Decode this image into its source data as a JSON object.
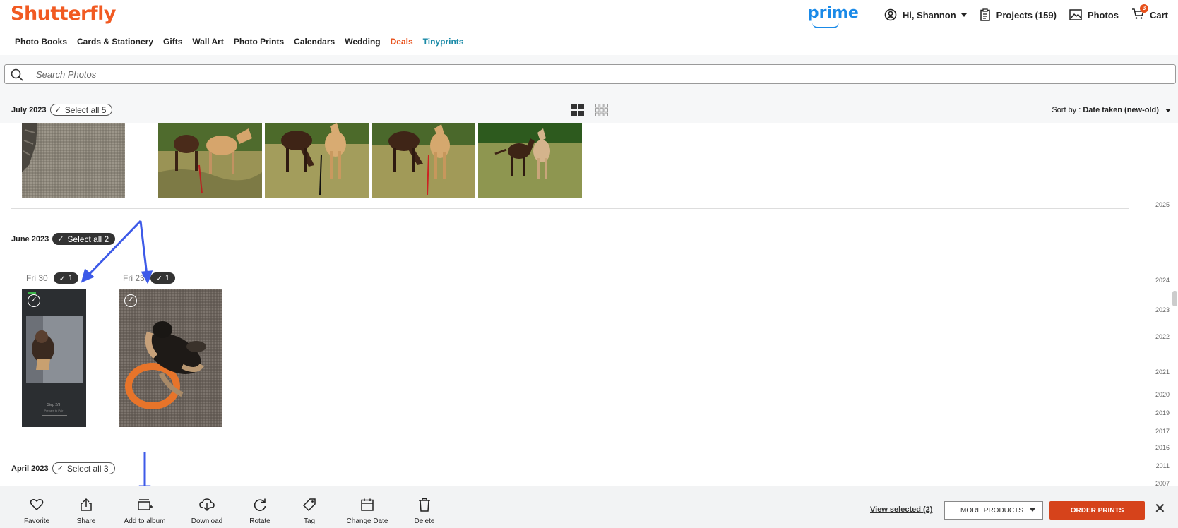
{
  "header": {
    "logo": "Shutterfly",
    "prime": "prime",
    "greeting": "Hi, Shannon",
    "projects": "Projects (159)",
    "photos": "Photos",
    "cart": "Cart",
    "cart_count": "3",
    "brand_color": "#f15a22"
  },
  "nav": [
    "Photo Books",
    "Cards & Stationery",
    "Gifts",
    "Wall Art",
    "Photo Prints",
    "Calendars",
    "Wedding",
    "Deals",
    "Tinyprints"
  ],
  "search": {
    "placeholder": "Search Photos"
  },
  "sort": {
    "prefix": "Sort by : ",
    "value": "Date taken (new-old)"
  },
  "groups": {
    "july": {
      "label": "July 2023",
      "select": "Select all 5"
    },
    "june": {
      "label": "June 2023",
      "select": "Select all 2"
    },
    "april": {
      "label": "April 2023",
      "select": "Select all 3"
    }
  },
  "days": [
    {
      "label": "Fri 30",
      "count": "1"
    },
    {
      "label": "Fri 23",
      "count": "1"
    }
  ],
  "phone_text": {
    "step": "Step 2/3",
    "sub": "Prepare to Pair"
  },
  "timeline": [
    "2025",
    "2024",
    "2023",
    "2022",
    "2021",
    "2020",
    "2019",
    "2017",
    "2016",
    "2011",
    "2007"
  ],
  "toolbar": {
    "favorite": "Favorite",
    "share": "Share",
    "add_album": "Add to album",
    "download": "Download",
    "rotate": "Rotate",
    "tag": "Tag",
    "change_date": "Change Date",
    "delete": "Delete",
    "view_selected": "View selected (2)",
    "more_products": "MORE PRODUCTS",
    "order_prints": "ORDER PRINTS"
  }
}
